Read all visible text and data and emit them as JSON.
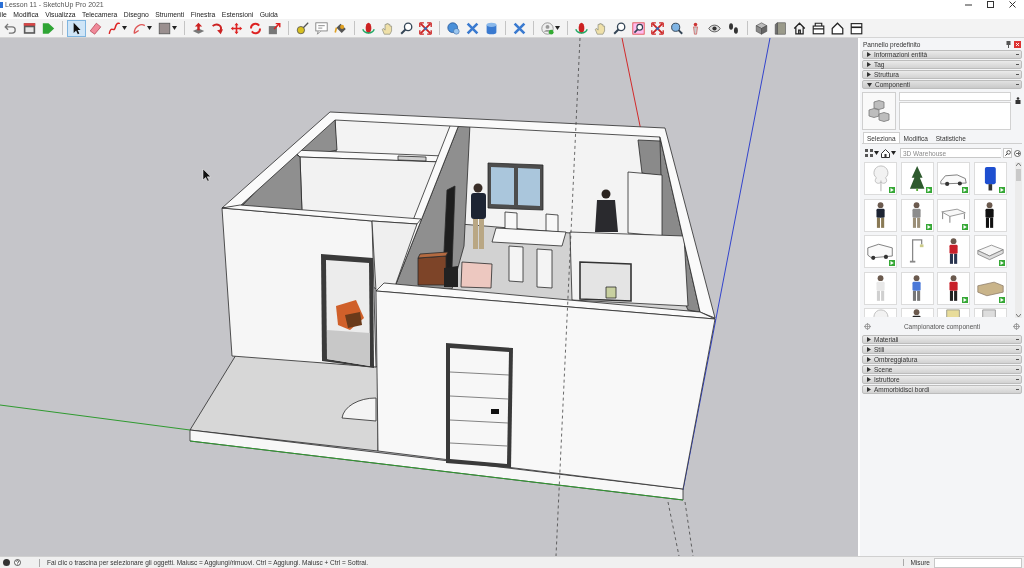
{
  "window": {
    "title": "Lesson 11 - SketchUp Pro 2021"
  },
  "menu": [
    "ile",
    "Modifica",
    "Visualizza",
    "Telecamera",
    "Disegno",
    "Strumenti",
    "Finestra",
    "Estensioni",
    "Guida"
  ],
  "toolbar": [
    {
      "selected": false
    },
    {
      "selected": false
    },
    {
      "selected": false
    },
    {
      "selected": true
    },
    {
      "selected": false
    },
    {
      "selected": false
    },
    {
      "selected": false
    },
    {
      "selected": false
    },
    {
      "selected": false
    },
    {
      "selected": false
    },
    {
      "selected": false
    },
    {
      "selected": false
    },
    {
      "selected": false
    },
    {
      "selected": false
    },
    {
      "selected": false
    },
    {
      "selected": false
    },
    {
      "selected": false
    },
    {
      "selected": false
    },
    {
      "selected": false
    },
    {
      "selected": false
    },
    {
      "selected": false
    },
    {
      "selected": false
    },
    {
      "selected": false
    },
    {
      "selected": false
    },
    {
      "selected": false
    },
    {
      "selected": false
    },
    {
      "selected": false
    },
    {
      "selected": false
    },
    {
      "selected": false
    },
    {
      "selected": false
    },
    {
      "selected": false
    },
    {
      "selected": false
    },
    {
      "selected": false
    },
    {
      "selected": false
    },
    {
      "selected": false
    },
    {
      "selected": false
    },
    {
      "selected": false
    },
    {
      "selected": false
    },
    {
      "selected": false
    },
    {
      "selected": false
    }
  ],
  "tray": {
    "title": "Pannello predefinito",
    "sections": [
      {
        "label": "Informazioni entità",
        "expanded": false
      },
      {
        "label": "Tag",
        "expanded": false
      },
      {
        "label": "Struttura",
        "expanded": false
      },
      {
        "label": "Componenti",
        "expanded": true
      },
      {
        "label": "Materiali",
        "expanded": false
      },
      {
        "label": "Stili",
        "expanded": false
      },
      {
        "label": "Ombreggiatura",
        "expanded": false
      },
      {
        "label": "Scene",
        "expanded": false
      },
      {
        "label": "Istruttore",
        "expanded": false
      },
      {
        "label": "Ammorbidisci bordi",
        "expanded": false
      }
    ],
    "components": {
      "tabs": [
        {
          "label": "Seleziona",
          "selected": true
        },
        {
          "label": "Modifica",
          "selected": false
        },
        {
          "label": "Statistiche",
          "selected": false
        }
      ],
      "search": {
        "placeholder": "3D Warehouse"
      },
      "items": [
        {
          "badge": true
        },
        {
          "badge": true
        },
        {
          "badge": true
        },
        {
          "badge": true
        },
        {
          "badge": false
        },
        {
          "badge": true
        },
        {
          "badge": true
        },
        {
          "badge": false
        },
        {
          "badge": true
        },
        {
          "badge": false
        },
        {
          "badge": false
        },
        {
          "badge": true
        },
        {
          "badge": false
        },
        {
          "badge": false
        },
        {
          "badge": true
        },
        {
          "badge": true
        },
        {
          "badge": false
        },
        {
          "badge": false
        },
        {
          "badge": false
        },
        {
          "badge": false
        }
      ],
      "footer": "Campionatore componenti"
    }
  },
  "status_bar": {
    "hint": "Fai clic o trascina per selezionare gli oggetti. Maiusc = Aggiungi/rimuovi. Ctrl = Aggiungi. Maiusc + Ctrl = Sottrai.",
    "measurements_label": "Misure"
  }
}
